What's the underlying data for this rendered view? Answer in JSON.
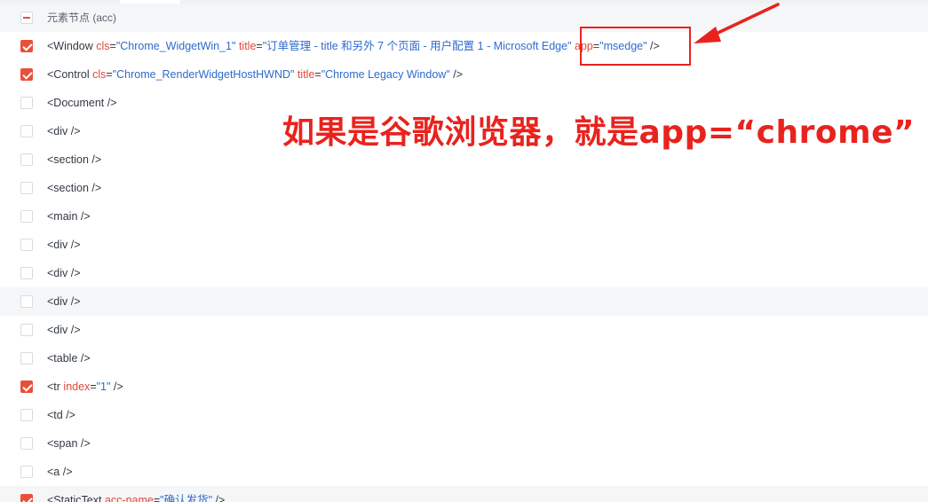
{
  "header": {
    "label": "元素节点 (acc)"
  },
  "rows": [
    {
      "checked": true,
      "tokens": [
        {
          "t": "tag",
          "v": "<Window "
        },
        {
          "t": "attr",
          "v": "cls"
        },
        {
          "t": "tag",
          "v": "="
        },
        {
          "t": "val",
          "v": "\"Chrome_WidgetWin_1\""
        },
        {
          "t": "tag",
          "v": " "
        },
        {
          "t": "attr",
          "v": "title"
        },
        {
          "t": "tag",
          "v": "="
        },
        {
          "t": "val",
          "v": "\"订单管理 - title 和另外 7 个页面 - 用户配置 1 - Microsoft Edge\""
        },
        {
          "t": "tag",
          "v": " "
        },
        {
          "t": "attr",
          "v": "app"
        },
        {
          "t": "tag",
          "v": "="
        },
        {
          "t": "val",
          "v": "\"msedge\""
        },
        {
          "t": "tag",
          "v": " />"
        }
      ]
    },
    {
      "checked": true,
      "tokens": [
        {
          "t": "tag",
          "v": "<Control "
        },
        {
          "t": "attr",
          "v": "cls"
        },
        {
          "t": "tag",
          "v": "="
        },
        {
          "t": "val",
          "v": "\"Chrome_RenderWidgetHostHWND\""
        },
        {
          "t": "tag",
          "v": " "
        },
        {
          "t": "attr",
          "v": "title"
        },
        {
          "t": "tag",
          "v": "="
        },
        {
          "t": "val",
          "v": "\"Chrome Legacy Window\""
        },
        {
          "t": "tag",
          "v": " />"
        }
      ]
    },
    {
      "checked": false,
      "tokens": [
        {
          "t": "tag",
          "v": "<Document />"
        }
      ]
    },
    {
      "checked": false,
      "tokens": [
        {
          "t": "tag",
          "v": "<div />"
        }
      ]
    },
    {
      "checked": false,
      "tokens": [
        {
          "t": "tag",
          "v": "<section />"
        }
      ]
    },
    {
      "checked": false,
      "tokens": [
        {
          "t": "tag",
          "v": "<section />"
        }
      ]
    },
    {
      "checked": false,
      "tokens": [
        {
          "t": "tag",
          "v": "<main />"
        }
      ]
    },
    {
      "checked": false,
      "tokens": [
        {
          "t": "tag",
          "v": "<div />"
        }
      ]
    },
    {
      "checked": false,
      "tokens": [
        {
          "t": "tag",
          "v": "<div />"
        }
      ]
    },
    {
      "checked": false,
      "shaded": true,
      "tokens": [
        {
          "t": "tag",
          "v": "<div />"
        }
      ]
    },
    {
      "checked": false,
      "tokens": [
        {
          "t": "tag",
          "v": "<div />"
        }
      ]
    },
    {
      "checked": false,
      "tokens": [
        {
          "t": "tag",
          "v": "<table />"
        }
      ]
    },
    {
      "checked": true,
      "tokens": [
        {
          "t": "tag",
          "v": "<tr "
        },
        {
          "t": "attr",
          "v": "index"
        },
        {
          "t": "tag",
          "v": "="
        },
        {
          "t": "val",
          "v": "\"1\""
        },
        {
          "t": "tag",
          "v": " />"
        }
      ]
    },
    {
      "checked": false,
      "tokens": [
        {
          "t": "tag",
          "v": "<td />"
        }
      ]
    },
    {
      "checked": false,
      "tokens": [
        {
          "t": "tag",
          "v": "<span />"
        }
      ]
    },
    {
      "checked": false,
      "tokens": [
        {
          "t": "tag",
          "v": "<a />"
        }
      ]
    },
    {
      "checked": true,
      "shaded": true,
      "tokens": [
        {
          "t": "tag",
          "v": "<StaticText "
        },
        {
          "t": "attr",
          "v": "acc-name"
        },
        {
          "t": "tag",
          "v": "="
        },
        {
          "t": "val",
          "v": "\"确认发货\""
        },
        {
          "t": "tag",
          "v": " />"
        }
      ]
    }
  ],
  "annotation": {
    "text": "如果是谷歌浏览器，就是app=“chrome”"
  },
  "colors": {
    "accent": "#e8503a",
    "annotation": "#e8231e",
    "attr": "#e0483b",
    "value": "#2f6bcd",
    "text": "#333a44"
  }
}
